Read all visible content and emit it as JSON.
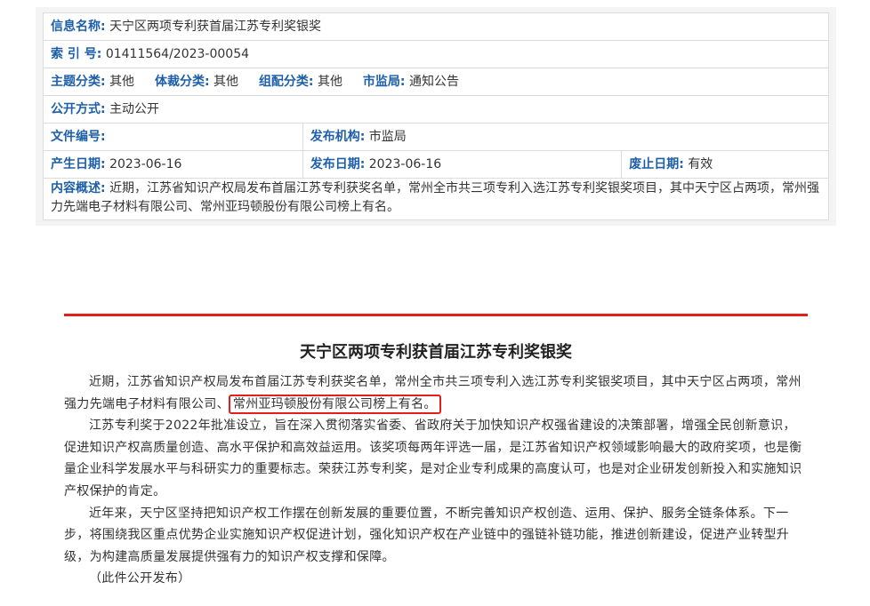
{
  "meta": {
    "info_name_label": "信息名称:",
    "info_name": "天宁区两项专利获首届江苏专利奖银奖",
    "index_label": "索 引 号:",
    "index": "01411564/2023-00054",
    "topic_label": "主题分类:",
    "topic": "其他",
    "genre_label": "体裁分类:",
    "genre": "其他",
    "group_label": "组配分类:",
    "group": "其他",
    "bureau_label": "市监局:",
    "bureau": "通知公告",
    "disclosure_label": "公开方式:",
    "disclosure": "主动公开",
    "doc_no_label": "文件编号:",
    "doc_no": "",
    "issuer_label": "发布机构:",
    "issuer": "市监局",
    "created_label": "产生日期:",
    "created": "2023-06-16",
    "published_label": "发布日期:",
    "published": "2023-06-16",
    "expiry_label": "废止日期:",
    "expiry": "有效",
    "summary_label": "内容概述:",
    "summary": "近期，江苏省知识产权局发布首届江苏专利获奖名单，常州全市共三项专利入选江苏专利奖银奖项目，其中天宁区占两项，常州强力先端电子材料有限公司、常州亚玛顿股份有限公司榜上有名。"
  },
  "article": {
    "title": "天宁区两项专利获首届江苏专利奖银奖",
    "p1_before": "近期，江苏省知识产权局发布首届江苏专利获奖名单，常州全市共三项专利入选江苏专利奖银奖项目，其中天宁区占两项，常州强力先端电子材料有限公司、",
    "p1_highlight": "常州亚玛顿股份有限公司榜上有名。",
    "p2": "江苏专利奖于2022年批准设立，旨在深入贯彻落实省委、省政府关于加快知识产权强省建设的决策部署，增强全民创新意识，促进知识产权高质量创造、高水平保护和高效益运用。该奖项每两年评选一届，是江苏省知识产权领域影响最大的政府奖项，也是衡量企业科学发展水平与科研实力的重要标志。荣获江苏专利奖，是对企业专利成果的高度认可，也是对企业研发创新投入和实施知识产权保护的肯定。",
    "p3": "近年来，天宁区坚持把知识产权工作摆在创新发展的重要位置，不断完善知识产权创造、运用、保护、服务全链条体系。下一步，将围绕我区重点优势企业实施知识产权促进计划，强化知识产权在产业链中的强链补链功能，推进创新建设，促进产业转型升级，为构建高质量发展提供强有力的知识产权支撑和保障。",
    "footer": "（此件公开发布）"
  }
}
